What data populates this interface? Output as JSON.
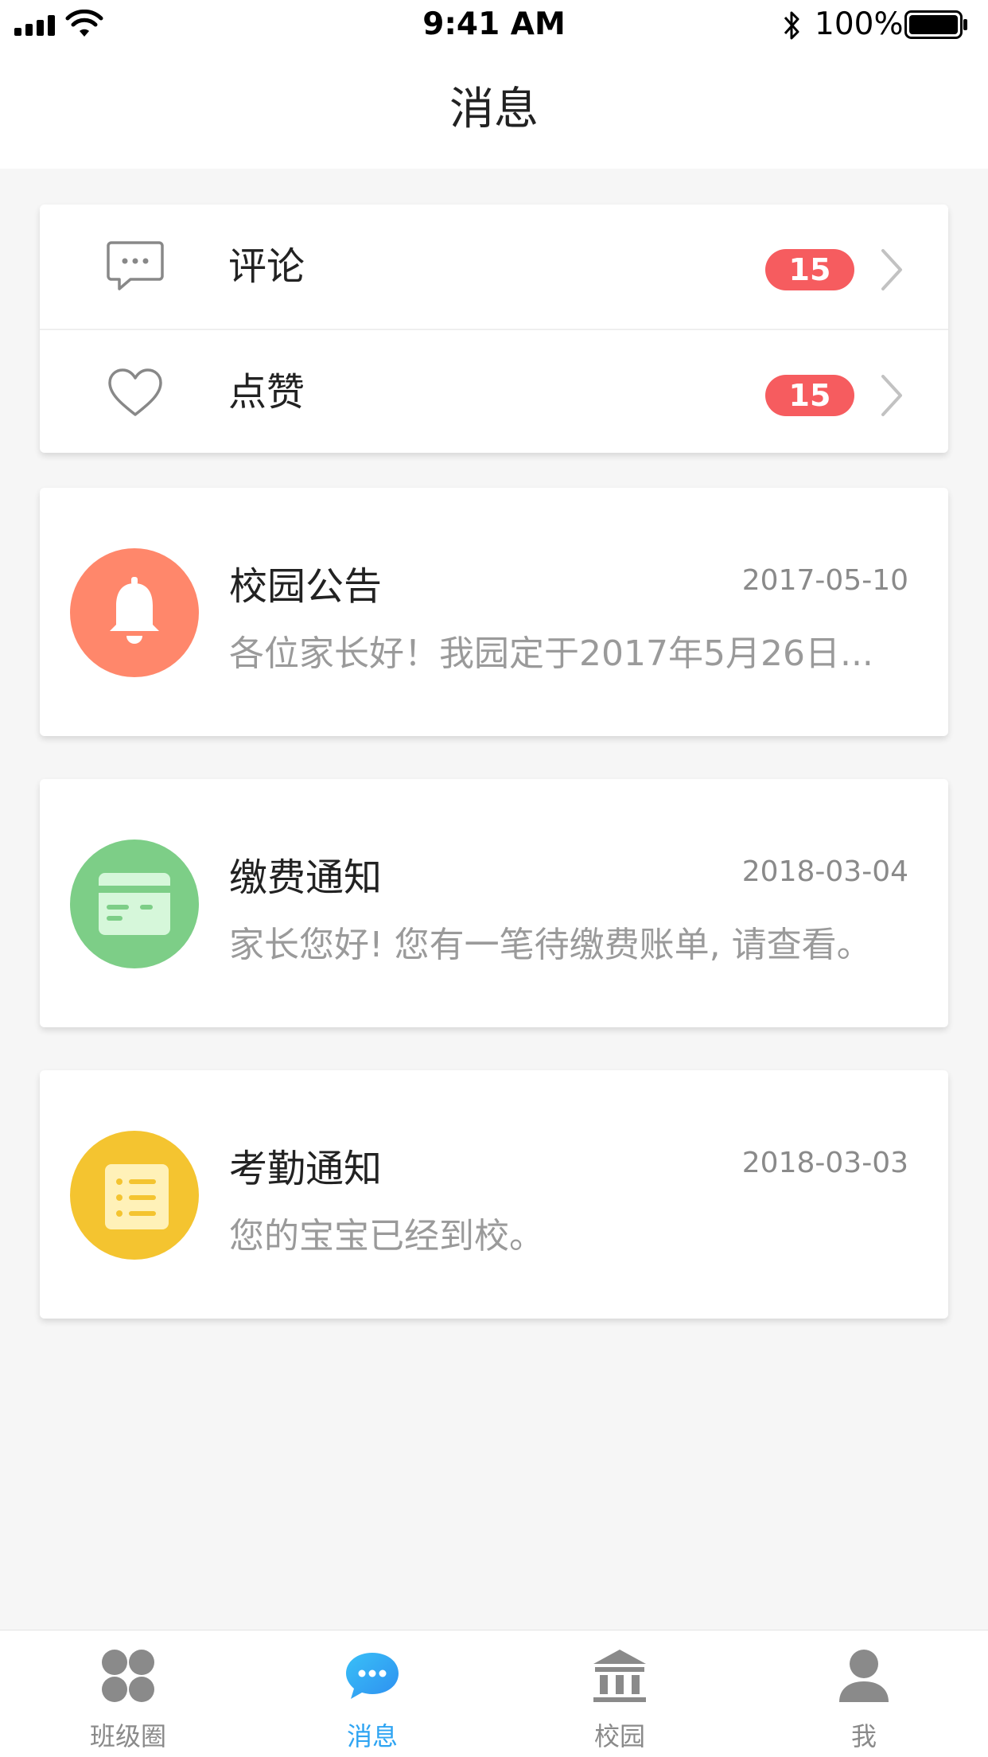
{
  "status_bar": {
    "time": "9:41 AM",
    "battery_percent": "100%",
    "icons": [
      "signal-icon",
      "wifi-icon",
      "bluetooth-icon",
      "battery-icon"
    ]
  },
  "nav": {
    "title": "消息"
  },
  "interactions": [
    {
      "label": "评论",
      "count": "15",
      "icon": "comment-bubble-icon"
    },
    {
      "label": "点赞",
      "count": "15",
      "icon": "heart-icon"
    }
  ],
  "notices": [
    {
      "title": "校园公告",
      "date": "2017-05-10",
      "body": "各位家长好！我园定于2017年5月26日...",
      "icon": "bell-icon",
      "color": "#ff876b"
    },
    {
      "title": "缴费通知",
      "date": "2018-03-04",
      "body": "家长您好! 您有一笔待缴费账单, 请查看。",
      "icon": "card-icon",
      "color": "#7dce87"
    },
    {
      "title": "考勤通知",
      "date": "2018-03-03",
      "body": "您的宝宝已经到校。",
      "icon": "checklist-icon",
      "color": "#f4c430"
    }
  ],
  "tabs": [
    {
      "label": "班级圈",
      "icon": "clover-icon",
      "active": false
    },
    {
      "label": "消息",
      "icon": "chat-icon",
      "active": true
    },
    {
      "label": "校园",
      "icon": "school-building-icon",
      "active": false
    },
    {
      "label": "我",
      "icon": "person-icon",
      "active": false
    }
  ],
  "colors": {
    "badge": "#f65c5f",
    "active_tab": "#2ea4f2",
    "background": "#f6f6f6"
  }
}
